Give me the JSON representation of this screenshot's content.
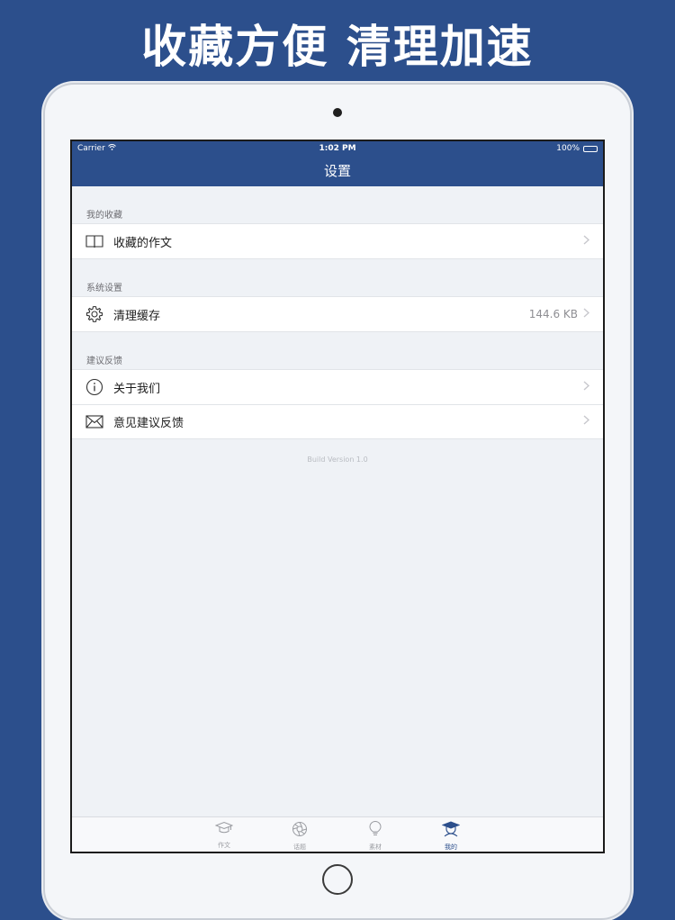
{
  "promo": {
    "title": "收藏方便 清理加速"
  },
  "status_bar": {
    "carrier": "Carrier",
    "time": "1:02 PM",
    "battery": "100%"
  },
  "nav": {
    "title": "设置"
  },
  "sections": [
    {
      "header": "我的收藏",
      "rows": [
        {
          "icon": "book-icon",
          "label": "收藏的作文",
          "detail": ""
        }
      ]
    },
    {
      "header": "系统设置",
      "rows": [
        {
          "icon": "gear-icon",
          "label": "清理缓存",
          "detail": "144.6 KB"
        }
      ]
    },
    {
      "header": "建议反馈",
      "rows": [
        {
          "icon": "info-icon",
          "label": "关于我们",
          "detail": ""
        },
        {
          "icon": "envelope-icon",
          "label": "意见建议反馈",
          "detail": ""
        }
      ]
    }
  ],
  "build": "Build Version 1.0",
  "tabs": [
    {
      "icon": "graduation-cap-icon",
      "label": "作文",
      "active": false
    },
    {
      "icon": "aperture-icon",
      "label": "话题",
      "active": false
    },
    {
      "icon": "lightbulb-icon",
      "label": "素材",
      "active": false
    },
    {
      "icon": "student-icon",
      "label": "我的",
      "active": true
    }
  ],
  "colors": {
    "brand": "#2c4f8c",
    "background": "#eff2f6",
    "chevron": "#c7c7cc"
  }
}
